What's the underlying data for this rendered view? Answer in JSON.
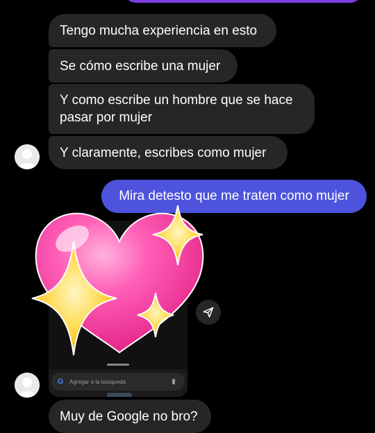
{
  "colors": {
    "background": "#000000",
    "received_bubble": "#262626",
    "sent_bubble": "#4d53dc",
    "top_sent_bubble": "#7b3fe0",
    "heart_pink": "#ff3fa4",
    "sparkle_yellow": "#ffd23a"
  },
  "messages": [
    {
      "sender": "them",
      "text": "Tengo mucha experiencia en esto"
    },
    {
      "sender": "them",
      "text": "Se cómo escribe una mujer"
    },
    {
      "sender": "them",
      "text": "Y como escribe un hombre que se hace pasar por mujer"
    },
    {
      "sender": "them",
      "text": "Y claramente, escribes como mujer"
    },
    {
      "sender": "me",
      "text": "Mira detesto que me traten como mujer"
    },
    {
      "sender": "them",
      "text": "Muy de Google no bro?"
    }
  ],
  "shared_post": {
    "search_placeholder": "Agregar a la búsqueda",
    "google_logo": "G",
    "icons": [
      "google-icon",
      "microphone-icon"
    ]
  },
  "sticker": {
    "name": "sparkling-heart",
    "icon": "sparkling-heart-icon"
  },
  "actions": {
    "share_icon": "send-arrow-icon"
  },
  "avatars": [
    "default-avatar-icon",
    "default-avatar-icon"
  ]
}
